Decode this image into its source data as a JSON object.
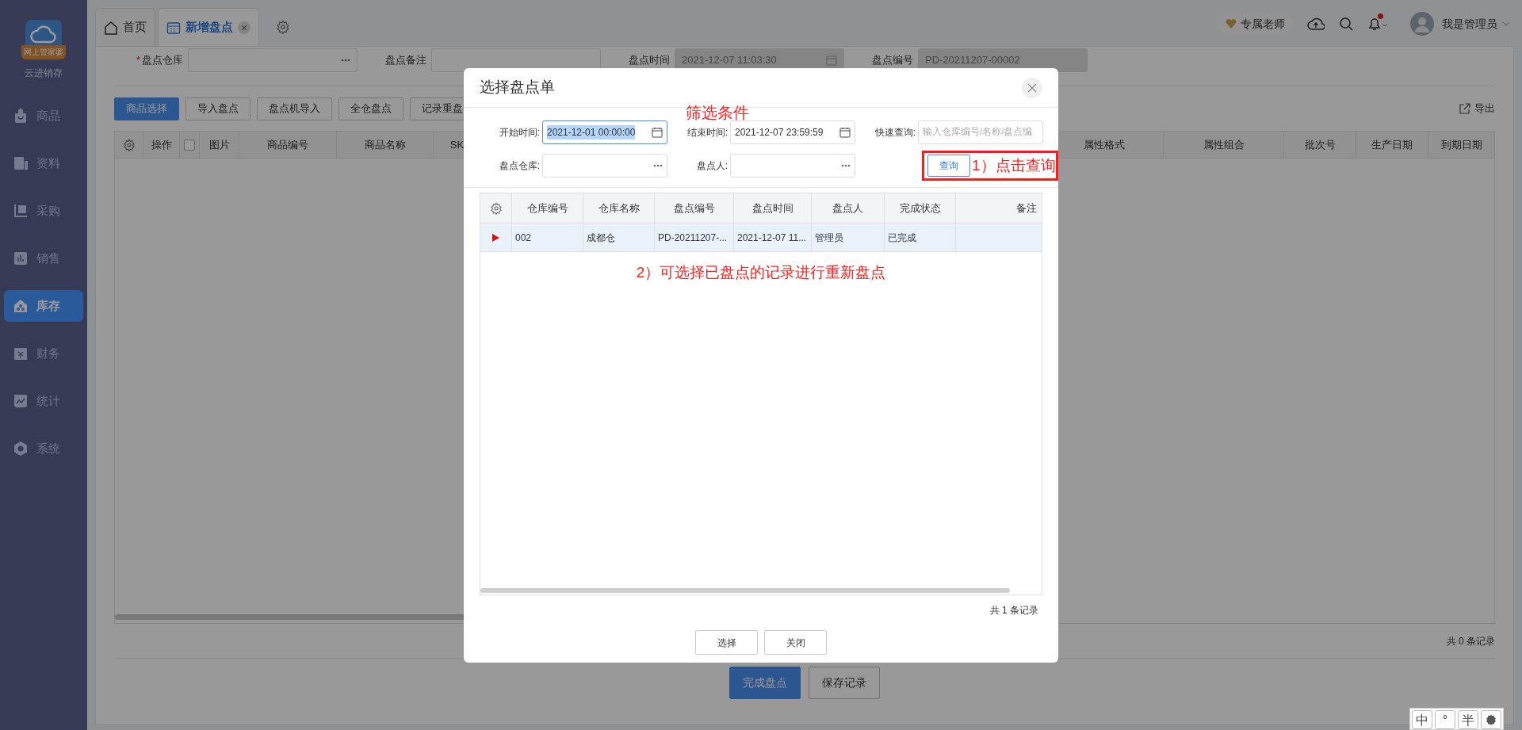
{
  "sidebar": {
    "logo_badge": "网上管家婆",
    "app_name": "云进销存",
    "items": [
      {
        "label": "商品",
        "selected": false
      },
      {
        "label": "资料",
        "selected": false
      },
      {
        "label": "采购",
        "selected": false
      },
      {
        "label": "销售",
        "selected": false
      },
      {
        "label": "库存",
        "selected": true
      },
      {
        "label": "财务",
        "selected": false
      },
      {
        "label": "统计",
        "selected": false
      },
      {
        "label": "系统",
        "selected": false
      }
    ]
  },
  "tabs": [
    {
      "label": "首页",
      "selected": false,
      "closable": false
    },
    {
      "label": "新增盘点",
      "selected": true,
      "closable": true
    }
  ],
  "header": {
    "teacher_badge": "专属老师",
    "notifications_unread": true,
    "user_name": "我是管理员"
  },
  "form": {
    "fields": [
      {
        "label": "盘点仓库",
        "required_mark": "*",
        "kind": "picker",
        "disabled": false
      },
      {
        "label": "盘点备注",
        "kind": "text",
        "disabled": false
      },
      {
        "label": "盘点时间",
        "kind": "date",
        "disabled": true,
        "value": "2021-12-07 11:03:30"
      },
      {
        "label": "盘点编号",
        "kind": "text",
        "disabled": true,
        "value": "PD-20211207-00002"
      }
    ]
  },
  "toolbar": {
    "buttons": [
      {
        "label": "商品选择",
        "primary": true
      },
      {
        "label": "导入盘点",
        "primary": false
      },
      {
        "label": "盘点机导入",
        "primary": false
      },
      {
        "label": "全仓盘点",
        "primary": false
      },
      {
        "label": "记录重盘",
        "primary": false
      }
    ],
    "export": "导出"
  },
  "table": {
    "columns": [
      {
        "kind": "text",
        "label": "操作"
      },
      {
        "kind": "checkbox",
        "checked": false
      },
      {
        "kind": "text",
        "label": "图片"
      },
      {
        "kind": "text",
        "label": "商品编号"
      },
      {
        "kind": "text",
        "label": "商品名称"
      },
      {
        "kind": "text",
        "label": "SK"
      }
    ],
    "columns_right": [
      "属性格式",
      "属性组合",
      "批次号",
      "生产日期",
      "到期日期"
    ],
    "total": "共 0 条记录"
  },
  "bottom_buttons": [
    {
      "label": "完成盘点",
      "primary": true
    },
    {
      "label": "保存记录",
      "primary": false
    }
  ],
  "dialog": {
    "title": "选择盘点单",
    "filters": [
      {
        "label": "开始时间:",
        "kind": "date",
        "value": "2021-12-01 00:00:00",
        "focused": true,
        "text_selected": true
      },
      {
        "label": "结束时间:",
        "kind": "date",
        "value": "2021-12-07 23:59:59",
        "focused": false,
        "text_selected": false
      },
      {
        "label": "快速查询:",
        "kind": "search",
        "placeholder": "输入仓库编号/名称/盘点编",
        "focused": false
      },
      {
        "label": "盘点仓库:",
        "kind": "picker",
        "focused": false
      },
      {
        "label": "盘点人:",
        "kind": "picker",
        "focused": false
      }
    ],
    "query_button": "查询",
    "columns": [
      "仓库编号",
      "仓库名称",
      "盘点编号",
      "盘点时间",
      "盘点人",
      "完成状态",
      "备注"
    ],
    "rows": [
      {
        "selected": true,
        "cells": [
          "002",
          "成都仓",
          "PD-20211207-...",
          "2021-12-07 11...",
          "管理员",
          "已完成"
        ]
      }
    ],
    "total": "共 1 条记录",
    "buttons": [
      "选择",
      "关闭"
    ],
    "annotations": {
      "filter_note": "筛选条件",
      "step_1": "1）点击查询",
      "step_2": "2）可选择已盘点的记录进行重新盘点"
    }
  },
  "ime_toolbar": [
    "中",
    "°",
    "半"
  ]
}
